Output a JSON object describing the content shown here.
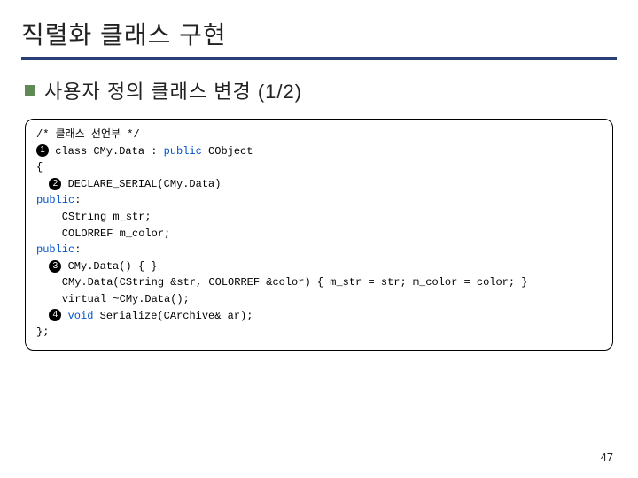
{
  "title": "직렬화 클래스 구현",
  "subheading": "사용자 정의 클래스 변경 (1/2)",
  "code": {
    "comment": "/* 클래스 선언부 */",
    "n1": "1",
    "line1_pre": " class CMy.Data : ",
    "line1_kw": "public",
    "line1_post": " CObject",
    "brace_open": "{",
    "n2": "2",
    "line2": " DECLARE_SERIAL(CMy.Data)",
    "public1": "public",
    "colon": ":",
    "m_str": "    CString m_str;",
    "m_color": "    COLORREF m_color;",
    "public2": "public",
    "n3": "3",
    "line3": " CMy.Data() { }",
    "ctor2": "    CMy.Data(CString &str, COLORREF &color) { m_str = str; m_color = color; }",
    "dtor": "    virtual ~CMy.Data();",
    "n4": "4",
    "line4_pre": " ",
    "line4_kw": "void",
    "line4_post": " Serialize(CArchive& ar);",
    "brace_close": "};"
  },
  "page_number": "47"
}
